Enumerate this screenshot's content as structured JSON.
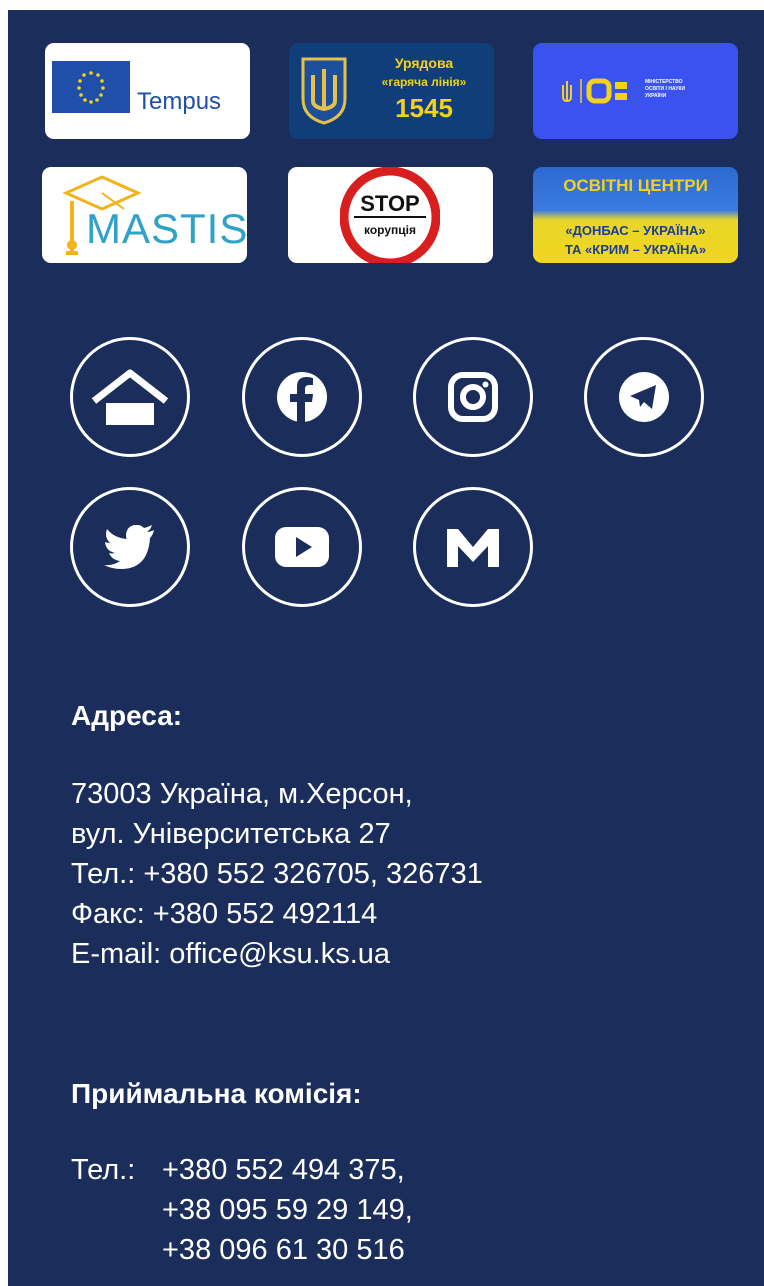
{
  "partners": {
    "tempus": {
      "label": "Tempus"
    },
    "hotline": {
      "line1": "Урядова",
      "line2": "«гаряча лінія»",
      "number": "1545"
    },
    "mon": {
      "line1": "МІНІСТЕРСТВО",
      "line2": "ОСВІТИ І НАУКИ",
      "line3": "УКРАЇНИ"
    },
    "mastis": {
      "label": "MASTIS"
    },
    "stop": {
      "line1": "STOP",
      "line2": "корупція"
    },
    "centers": {
      "line1": "ОСВІТНІ ЦЕНТРИ",
      "line2": "«ДОНБАС – УКРАЇНА»",
      "line3": "ТА «КРИМ – УКРАЇНА»"
    }
  },
  "social": [
    "home-icon",
    "facebook-icon",
    "instagram-icon",
    "telegram-icon",
    "twitter-icon",
    "youtube-icon",
    "medium-icon"
  ],
  "address": {
    "heading": "Адреса:",
    "lines": [
      "73003 Україна, м.Херсон,",
      "вул. Університетська 27",
      "Тел.: +380 552 326705, 326731",
      "Факс: +380 552 492114",
      "E-mail: office@ksu.ks.ua"
    ]
  },
  "admissions": {
    "heading": "Приймальна комісія:",
    "tel_label": "Тел.:",
    "phones": [
      "+380 552 494 375,",
      "+38 095 59 29 149,",
      "+38 096 61 30 516"
    ]
  },
  "colors": {
    "background": "#1b2d5a",
    "text": "#ffffff"
  }
}
